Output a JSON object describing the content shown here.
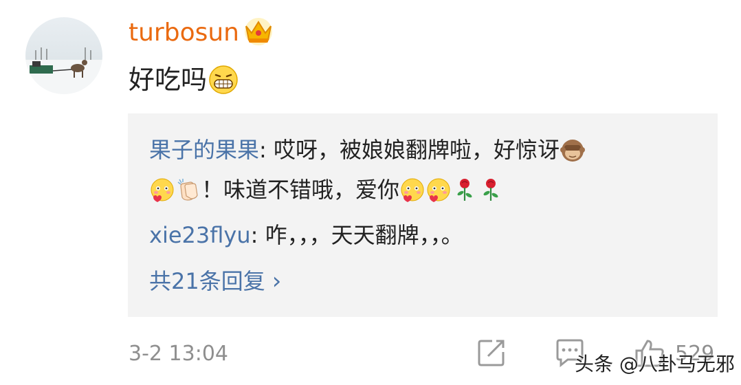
{
  "comment": {
    "username": "turbosun",
    "text": "好吃吗",
    "time": "3-2 13:04"
  },
  "replies": [
    {
      "author": "果子的果果",
      "text1": ": 哎呀，被娘娘翻牌啦，好惊讶",
      "text2": "！味道不错哦，爱你"
    },
    {
      "author": "xie23flyu",
      "text": ": 咋，，，天天翻牌，，。"
    }
  ],
  "more_replies": "共21条回复",
  "actions": {
    "like_count": "529"
  },
  "watermark": "头条 @八卦马无邪",
  "icons": [
    "crown-icon",
    "grin-emoji-icon",
    "see-no-evil-monkey-icon",
    "blush-heart-emoji-icon",
    "clapping-hands-icon",
    "rose-icon",
    "share-icon",
    "comment-icon",
    "thumbs-up-icon",
    "chevron-right-icon"
  ],
  "colors": {
    "username": "#ea6a10",
    "link": "#4a73a8",
    "reply_bg": "#f3f3f3",
    "meta": "#8f8f8f"
  }
}
